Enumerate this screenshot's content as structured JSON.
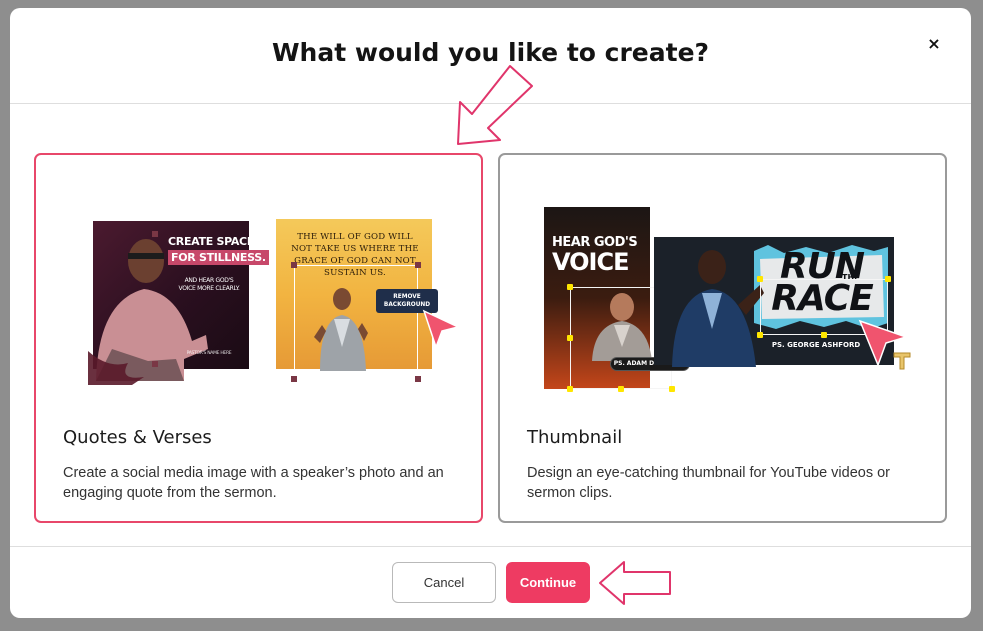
{
  "dialog": {
    "title": "What would you like to create?",
    "close_label": "×"
  },
  "options": [
    {
      "title": "Quotes & Verses",
      "description": "Create a social media image with a speaker’s photo and an engaging quote from the sermon.",
      "selected": true,
      "preview": {
        "headline_line1": "CREATE SPACE",
        "headline_line2": "FOR STILLNESS.",
        "subtext": "AND HEAR GOD'S VOICE MORE CLEARLY.",
        "footer": "PASTOR'S NAME HERE",
        "quote": "THE WILL OF GOD WILL NOT TAKE US WHERE THE GRACE OF GOD CAN NOT SUSTAIN US.",
        "remove_background_label": "REMOVE BACKGROUND"
      }
    },
    {
      "title": "Thumbnail",
      "description": "Design an eye-catching thumbnail for YouTube videos or sermon clips.",
      "selected": false,
      "preview": {
        "hear_line": "HEAR GOD'S",
        "voice_line": "VOICE",
        "speaker_a": "PS. ADAM DETAMORE",
        "run_line": "RUN",
        "the_line": "THE",
        "race_line": "RACE",
        "speaker_b": "PS. GEORGE ASHFORD"
      }
    }
  ],
  "footer": {
    "cancel_label": "Cancel",
    "continue_label": "Continue"
  },
  "colors": {
    "accent": "#ee3b62",
    "selected_border": "#e8476a",
    "annotation": "#e0356b"
  }
}
